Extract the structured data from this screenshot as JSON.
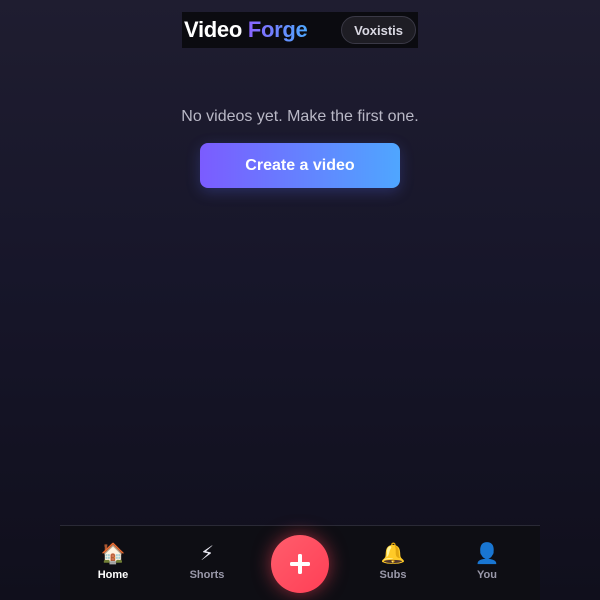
{
  "header": {
    "brand_word1": "Video",
    "brand_word2": "Forge",
    "user_name": "Voxistis"
  },
  "main": {
    "empty_message": "No videos yet. Make the first one.",
    "create_button_label": "Create a video"
  },
  "bottom_nav": {
    "items": [
      {
        "label": "Home",
        "icon": "house-icon",
        "glyph": "🏠",
        "active": true
      },
      {
        "label": "Shorts",
        "icon": "lightning-icon",
        "glyph": "⚡",
        "active": false
      },
      {
        "label": "Subs",
        "icon": "bell-icon",
        "glyph": "🔔",
        "active": false
      },
      {
        "label": "You",
        "icon": "user-icon",
        "glyph": "👤",
        "active": false
      }
    ],
    "fab_icon": "plus-icon"
  },
  "colors": {
    "background": "#17162a",
    "accent_start": "#7b5cff",
    "accent_end": "#4fa6ff",
    "fab": "#ff4a5e"
  }
}
